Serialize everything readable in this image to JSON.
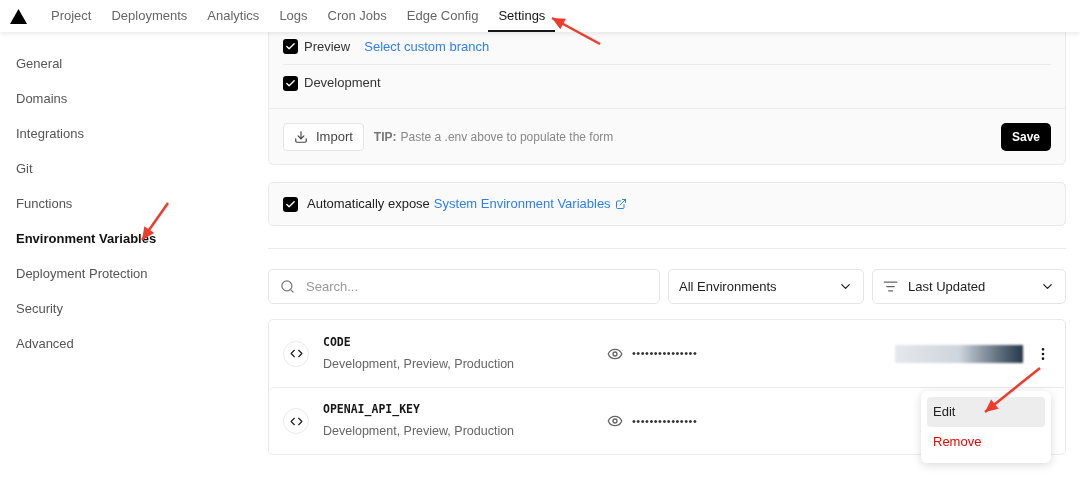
{
  "tabs": [
    {
      "label": "Project",
      "selected": false
    },
    {
      "label": "Deployments",
      "selected": false
    },
    {
      "label": "Analytics",
      "selected": false
    },
    {
      "label": "Logs",
      "selected": false
    },
    {
      "label": "Cron Jobs",
      "selected": false
    },
    {
      "label": "Edge Config",
      "selected": false
    },
    {
      "label": "Settings",
      "selected": true
    }
  ],
  "sidebar": {
    "items": [
      {
        "label": "General",
        "selected": false
      },
      {
        "label": "Domains",
        "selected": false
      },
      {
        "label": "Integrations",
        "selected": false
      },
      {
        "label": "Git",
        "selected": false
      },
      {
        "label": "Functions",
        "selected": false
      },
      {
        "label": "Environment Variables",
        "selected": true
      },
      {
        "label": "Deployment Protection",
        "selected": false
      },
      {
        "label": "Security",
        "selected": false
      },
      {
        "label": "Advanced",
        "selected": false
      }
    ]
  },
  "environments": [
    {
      "label": "Preview",
      "checked": true,
      "link": "Select custom branch"
    },
    {
      "label": "Development",
      "checked": true
    }
  ],
  "form_footer": {
    "import_button": "Import",
    "tip_label": "TIP:",
    "tip": "Paste a .env above to populate the form",
    "save_button": "Save"
  },
  "system_vars": {
    "checked": true,
    "label": "Automatically expose",
    "link": "System Environment Variables"
  },
  "filters": {
    "search": {
      "placeholder": "Search..."
    },
    "environment": "All Environments",
    "sort": "Last Updated"
  },
  "variables": [
    {
      "name": "CODE",
      "environments": "Development, Preview, Production",
      "value": "•••••••••••••••",
      "redacted": true
    },
    {
      "name": "OPENAI_API_KEY",
      "environments": "Development, Preview, Production",
      "value": "•••••••••••••••",
      "redacted": false
    }
  ],
  "menu": {
    "items": [
      {
        "label": "Edit",
        "kind": "normal",
        "selected": true
      },
      {
        "label": "Remove",
        "kind": "danger",
        "selected": false
      }
    ]
  }
}
